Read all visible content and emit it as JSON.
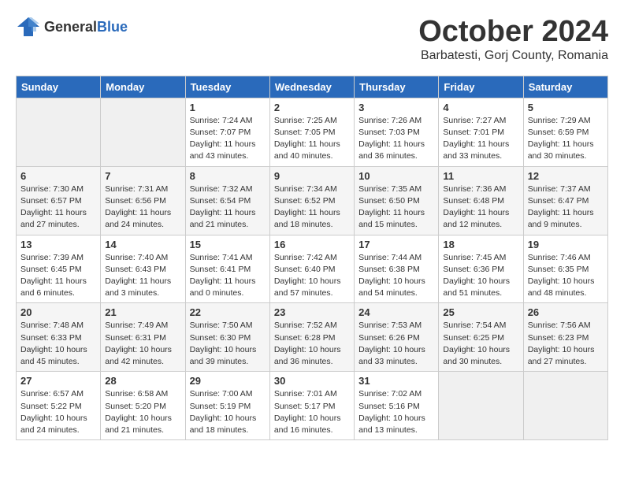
{
  "header": {
    "logo_general": "General",
    "logo_blue": "Blue",
    "month_title": "October 2024",
    "subtitle": "Barbatesti, Gorj County, Romania"
  },
  "calendar": {
    "days_of_week": [
      "Sunday",
      "Monday",
      "Tuesday",
      "Wednesday",
      "Thursday",
      "Friday",
      "Saturday"
    ],
    "weeks": [
      [
        {
          "day": "",
          "info": ""
        },
        {
          "day": "",
          "info": ""
        },
        {
          "day": "1",
          "info": "Sunrise: 7:24 AM\nSunset: 7:07 PM\nDaylight: 11 hours and 43 minutes."
        },
        {
          "day": "2",
          "info": "Sunrise: 7:25 AM\nSunset: 7:05 PM\nDaylight: 11 hours and 40 minutes."
        },
        {
          "day": "3",
          "info": "Sunrise: 7:26 AM\nSunset: 7:03 PM\nDaylight: 11 hours and 36 minutes."
        },
        {
          "day": "4",
          "info": "Sunrise: 7:27 AM\nSunset: 7:01 PM\nDaylight: 11 hours and 33 minutes."
        },
        {
          "day": "5",
          "info": "Sunrise: 7:29 AM\nSunset: 6:59 PM\nDaylight: 11 hours and 30 minutes."
        }
      ],
      [
        {
          "day": "6",
          "info": "Sunrise: 7:30 AM\nSunset: 6:57 PM\nDaylight: 11 hours and 27 minutes."
        },
        {
          "day": "7",
          "info": "Sunrise: 7:31 AM\nSunset: 6:56 PM\nDaylight: 11 hours and 24 minutes."
        },
        {
          "day": "8",
          "info": "Sunrise: 7:32 AM\nSunset: 6:54 PM\nDaylight: 11 hours and 21 minutes."
        },
        {
          "day": "9",
          "info": "Sunrise: 7:34 AM\nSunset: 6:52 PM\nDaylight: 11 hours and 18 minutes."
        },
        {
          "day": "10",
          "info": "Sunrise: 7:35 AM\nSunset: 6:50 PM\nDaylight: 11 hours and 15 minutes."
        },
        {
          "day": "11",
          "info": "Sunrise: 7:36 AM\nSunset: 6:48 PM\nDaylight: 11 hours and 12 minutes."
        },
        {
          "day": "12",
          "info": "Sunrise: 7:37 AM\nSunset: 6:47 PM\nDaylight: 11 hours and 9 minutes."
        }
      ],
      [
        {
          "day": "13",
          "info": "Sunrise: 7:39 AM\nSunset: 6:45 PM\nDaylight: 11 hours and 6 minutes."
        },
        {
          "day": "14",
          "info": "Sunrise: 7:40 AM\nSunset: 6:43 PM\nDaylight: 11 hours and 3 minutes."
        },
        {
          "day": "15",
          "info": "Sunrise: 7:41 AM\nSunset: 6:41 PM\nDaylight: 11 hours and 0 minutes."
        },
        {
          "day": "16",
          "info": "Sunrise: 7:42 AM\nSunset: 6:40 PM\nDaylight: 10 hours and 57 minutes."
        },
        {
          "day": "17",
          "info": "Sunrise: 7:44 AM\nSunset: 6:38 PM\nDaylight: 10 hours and 54 minutes."
        },
        {
          "day": "18",
          "info": "Sunrise: 7:45 AM\nSunset: 6:36 PM\nDaylight: 10 hours and 51 minutes."
        },
        {
          "day": "19",
          "info": "Sunrise: 7:46 AM\nSunset: 6:35 PM\nDaylight: 10 hours and 48 minutes."
        }
      ],
      [
        {
          "day": "20",
          "info": "Sunrise: 7:48 AM\nSunset: 6:33 PM\nDaylight: 10 hours and 45 minutes."
        },
        {
          "day": "21",
          "info": "Sunrise: 7:49 AM\nSunset: 6:31 PM\nDaylight: 10 hours and 42 minutes."
        },
        {
          "day": "22",
          "info": "Sunrise: 7:50 AM\nSunset: 6:30 PM\nDaylight: 10 hours and 39 minutes."
        },
        {
          "day": "23",
          "info": "Sunrise: 7:52 AM\nSunset: 6:28 PM\nDaylight: 10 hours and 36 minutes."
        },
        {
          "day": "24",
          "info": "Sunrise: 7:53 AM\nSunset: 6:26 PM\nDaylight: 10 hours and 33 minutes."
        },
        {
          "day": "25",
          "info": "Sunrise: 7:54 AM\nSunset: 6:25 PM\nDaylight: 10 hours and 30 minutes."
        },
        {
          "day": "26",
          "info": "Sunrise: 7:56 AM\nSunset: 6:23 PM\nDaylight: 10 hours and 27 minutes."
        }
      ],
      [
        {
          "day": "27",
          "info": "Sunrise: 6:57 AM\nSunset: 5:22 PM\nDaylight: 10 hours and 24 minutes."
        },
        {
          "day": "28",
          "info": "Sunrise: 6:58 AM\nSunset: 5:20 PM\nDaylight: 10 hours and 21 minutes."
        },
        {
          "day": "29",
          "info": "Sunrise: 7:00 AM\nSunset: 5:19 PM\nDaylight: 10 hours and 18 minutes."
        },
        {
          "day": "30",
          "info": "Sunrise: 7:01 AM\nSunset: 5:17 PM\nDaylight: 10 hours and 16 minutes."
        },
        {
          "day": "31",
          "info": "Sunrise: 7:02 AM\nSunset: 5:16 PM\nDaylight: 10 hours and 13 minutes."
        },
        {
          "day": "",
          "info": ""
        },
        {
          "day": "",
          "info": ""
        }
      ]
    ]
  }
}
